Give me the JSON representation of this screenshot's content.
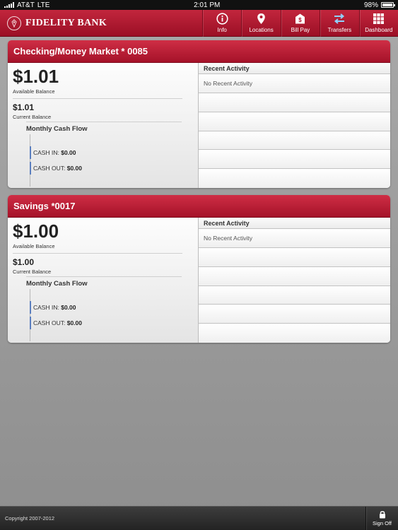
{
  "status_bar": {
    "carrier": "AT&T",
    "network": "LTE",
    "time": "2:01 PM",
    "battery": "98%",
    "battery_level": 0.98
  },
  "header": {
    "logo_text": "FIDELITY BANK",
    "nav": [
      {
        "label": "Info",
        "icon": "info-icon"
      },
      {
        "label": "Locations",
        "icon": "location-pin-icon"
      },
      {
        "label": "Bill Pay",
        "icon": "bill-pay-icon"
      },
      {
        "label": "Transfers",
        "icon": "transfer-arrows-icon"
      },
      {
        "label": "Dashboard",
        "icon": "grid-icon"
      }
    ]
  },
  "accounts": [
    {
      "name": "Checking/Money Market * 0085",
      "available_balance": "$1.01",
      "available_label": "Available Balance",
      "current_balance": "$1.01",
      "current_label": "Current Balance",
      "cash_flow_title": "Monthly Cash Flow",
      "cash_in_label": "CASH IN:",
      "cash_in": "$0.00",
      "cash_out_label": "CASH OUT:",
      "cash_out": "$0.00",
      "recent_activity_title": "Recent Activity",
      "recent_activity_empty": "No Recent Activity"
    },
    {
      "name": "Savings *0017",
      "available_balance": "$1.00",
      "available_label": "Available Balance",
      "current_balance": "$1.00",
      "current_label": "Current Balance",
      "cash_flow_title": "Monthly Cash Flow",
      "cash_in_label": "CASH IN:",
      "cash_in": "$0.00",
      "cash_out_label": "CASH OUT:",
      "cash_out": "$0.00",
      "recent_activity_title": "Recent Activity",
      "recent_activity_empty": "No Recent Activity"
    }
  ],
  "footer": {
    "copyright": "Copyright 2007-2012",
    "sign_off_label": "Sign Off",
    "sign_off_icon": "lock-icon"
  },
  "colors": {
    "brand_red": "#b3172f",
    "cash_flow_bar": "#5b7fbf"
  }
}
